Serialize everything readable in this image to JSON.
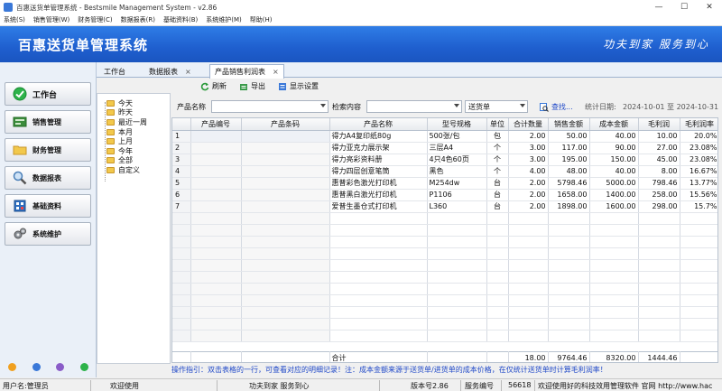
{
  "window": {
    "title": "百惠送货单管理系统 - Bestsmile Management System - v2.86"
  },
  "menu": [
    "系统(S)",
    "销售管理(W)",
    "财务管理(C)",
    "数据报表(R)",
    "基础资料(B)",
    "系统维护(M)",
    "帮助(H)"
  ],
  "banner": {
    "title": "百惠送货单管理系统",
    "slogan": "功夫到家  服务到心"
  },
  "nav": [
    {
      "label": "工作台",
      "icon": "check-circle-icon"
    },
    {
      "label": "销售管理",
      "icon": "cart-icon"
    },
    {
      "label": "财务管理",
      "icon": "folder-icon"
    },
    {
      "label": "数据报表",
      "icon": "magnifier-icon"
    },
    {
      "label": "基础资料",
      "icon": "database-icon"
    },
    {
      "label": "系统维护",
      "icon": "gears-icon"
    }
  ],
  "tabs": [
    {
      "label": "工作台"
    },
    {
      "label": "数据报表"
    },
    {
      "label": "产品销售利润表"
    }
  ],
  "toolbar": {
    "refresh": "刷新",
    "export": "导出",
    "display": "显示设置"
  },
  "filter": {
    "product_label": "产品名称",
    "search_label": "检索内容",
    "doc_type": "送货单",
    "search_btn": "查找...",
    "date_label": "统计日期:",
    "date_range": "2024-10-01 至 2024-10-31"
  },
  "date_filters": [
    "今天",
    "昨天",
    "最近一周",
    "本月",
    "上月",
    "今年",
    "全部",
    "自定义"
  ],
  "table": {
    "columns": [
      "",
      "产品编号",
      "产品条码",
      "产品名称",
      "型号规格",
      "单位",
      "合计数量",
      "销售金额",
      "成本金额",
      "毛利润",
      "毛利润率"
    ],
    "rows": [
      [
        "1",
        "",
        "",
        "得力A4复印纸80g",
        "500张/包",
        "包",
        "2.00",
        "50.00",
        "40.00",
        "10.00",
        "20.0%"
      ],
      [
        "2",
        "",
        "",
        "得力亚克力展示架",
        "三层A4",
        "个",
        "3.00",
        "117.00",
        "90.00",
        "27.00",
        "23.08%"
      ],
      [
        "3",
        "",
        "",
        "得力亮彩资料册",
        " 4只4色60页",
        "个",
        "3.00",
        "195.00",
        "150.00",
        "45.00",
        "23.08%"
      ],
      [
        "4",
        "",
        "",
        "得力四层创意笔筒",
        "黑色",
        "个",
        "4.00",
        "48.00",
        "40.00",
        "8.00",
        "16.67%"
      ],
      [
        "5",
        "",
        "",
        "惠普彩色激光打印机",
        "M254dw",
        "台",
        "2.00",
        "5798.46",
        "5000.00",
        "798.46",
        "13.77%"
      ],
      [
        "6",
        "",
        "",
        "惠普黑白激光打印机",
        "P1106",
        "台",
        "2.00",
        "1658.00",
        "1400.00",
        "258.00",
        "15.56%"
      ],
      [
        "7",
        "",
        "",
        "爱普生墨仓式打印机",
        "L360",
        "台",
        "2.00",
        "1898.00",
        "1600.00",
        "298.00",
        "15.7%"
      ]
    ],
    "total": {
      "label": "合计",
      "qty": "18.00",
      "sales": "9764.46",
      "cost": "8320.00",
      "profit": "1444.46"
    }
  },
  "tip": "操作指引：双击表格的一行，可查看对应的明细记录！注：成本金额来源于送货单/进货单的成本价格，在仅统计送货单时计算毛利润率！",
  "status": {
    "user": "用户名:管理员",
    "welcome": "欢迎使用",
    "motto": "功夫到家 服务到心",
    "version": "版本号2.86",
    "service_label": "服务编号",
    "service_no": "56618",
    "message": "欢迎使用好的科技效用管理软件 官网 http://www.hac"
  },
  "colors": {
    "banner": "#2f7de6",
    "tip": "#1f48c8"
  }
}
